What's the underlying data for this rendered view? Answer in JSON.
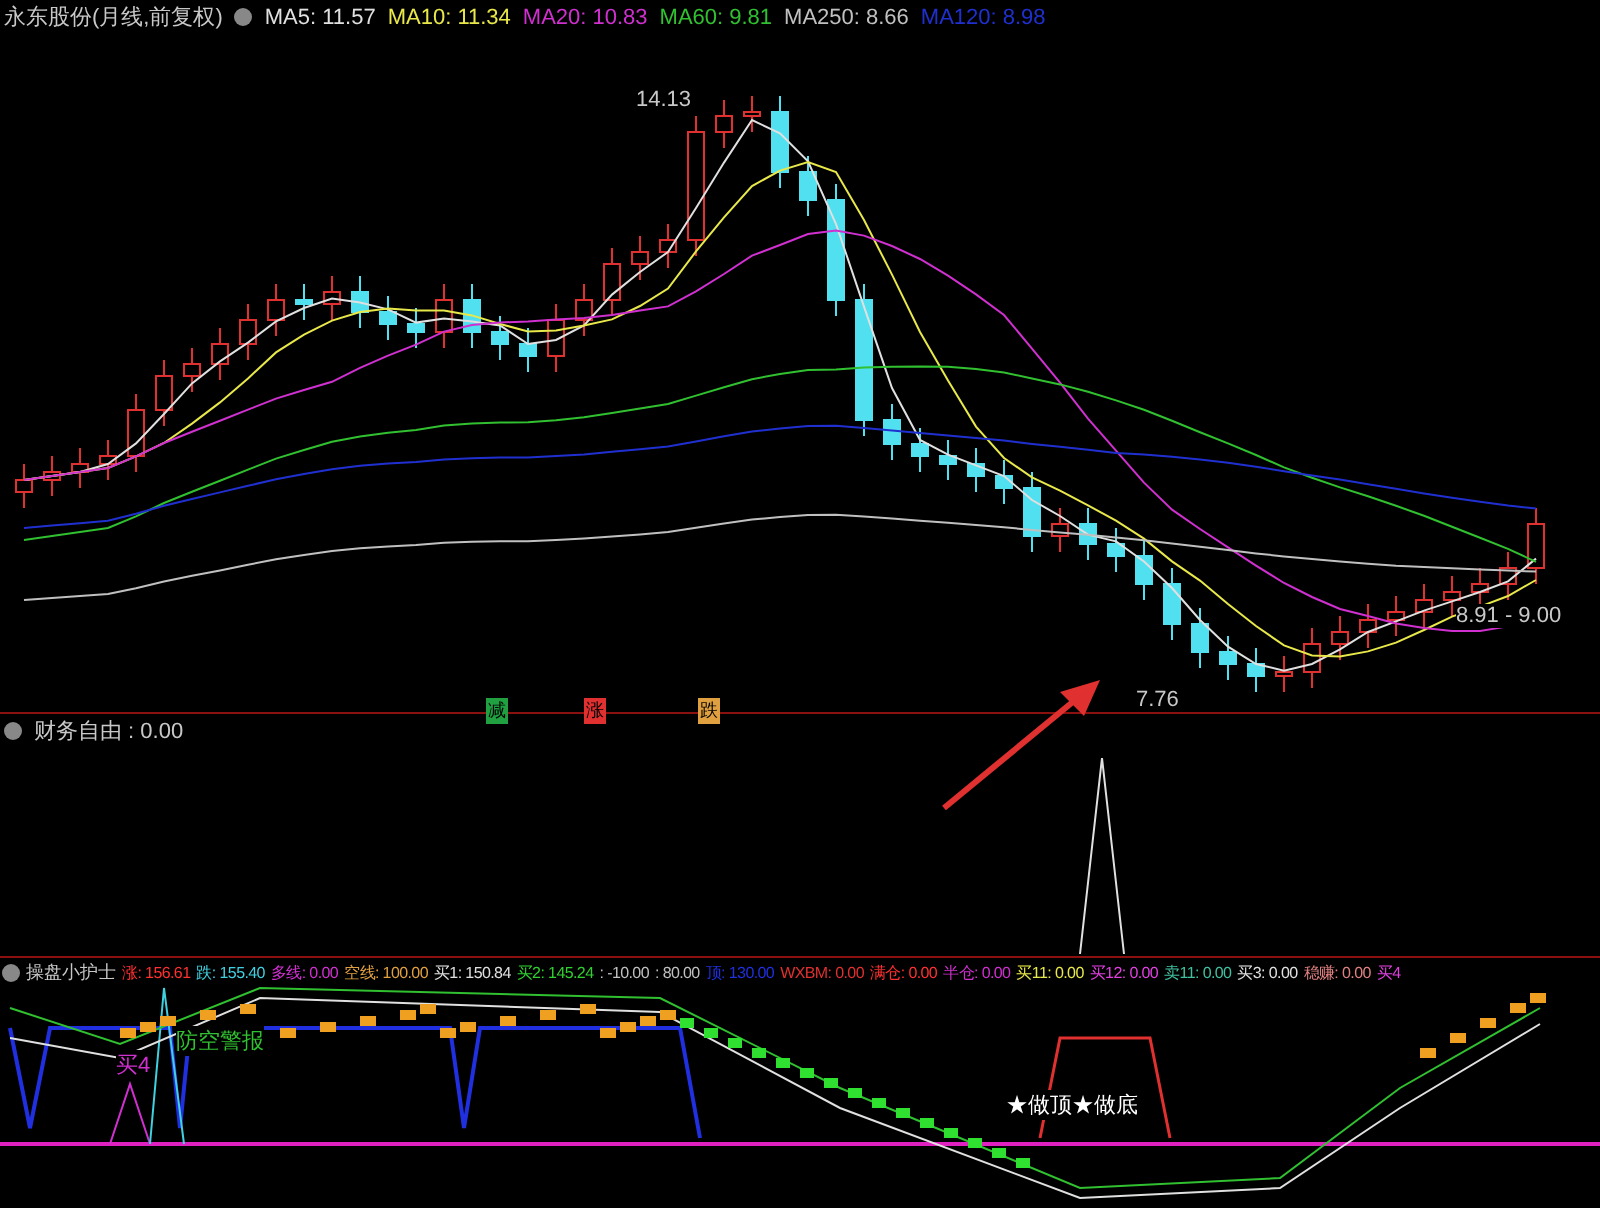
{
  "main_chart": {
    "title": "永东股份(月线,前复权)",
    "indicators": [
      {
        "label": "MA5: 11.57",
        "color": "#e0e0e0"
      },
      {
        "label": "MA10: 11.34",
        "color": "#e8e84a"
      },
      {
        "label": "MA20: 10.83",
        "color": "#d030d0"
      },
      {
        "label": "MA60: 9.81",
        "color": "#30c030"
      },
      {
        "label": "MA250: 8.66",
        "color": "#c0c0c0"
      },
      {
        "label": "MA120: 8.98",
        "color": "#2030d0"
      }
    ],
    "price_labels": [
      "14.13",
      "7.76",
      "8.91 - 9.00"
    ],
    "signal_tags": [
      {
        "text": "减",
        "color": "#20a040"
      },
      {
        "text": "涨",
        "color": "#e03030"
      },
      {
        "text": "跌",
        "color": "#e0a040"
      }
    ]
  },
  "sub_chart": {
    "title": "财务自由 : 0.00"
  },
  "nurse_chart": {
    "title": "操盘小护士",
    "readouts": [
      {
        "label": "涨: 156.61",
        "color": "#ff3030"
      },
      {
        "label": "跌: 155.40",
        "color": "#40d0e0"
      },
      {
        "label": "多线: 0.00",
        "color": "#d030d0"
      },
      {
        "label": "空线: 100.00",
        "color": "#e0a040"
      },
      {
        "label": "买1: 150.84",
        "color": "#e0e0e0"
      },
      {
        "label": "买2: 145.24",
        "color": "#30d030"
      },
      {
        "label": ": -10.00",
        "color": "#c0c0c0"
      },
      {
        "label": ": 80.00",
        "color": "#c0c0c0"
      },
      {
        "label": "顶: 130.00",
        "color": "#2030e0"
      },
      {
        "label": "WXBM: 0.00",
        "color": "#e03030"
      },
      {
        "label": "满仓: 0.00",
        "color": "#ff3030"
      },
      {
        "label": "半仓: 0.00",
        "color": "#d030d0"
      },
      {
        "label": "买11: 0.00",
        "color": "#e8e84a"
      },
      {
        "label": "买12: 0.00",
        "color": "#e040e0"
      },
      {
        "label": "卖11: 0.00",
        "color": "#40c0a0"
      },
      {
        "label": "买3: 0.00",
        "color": "#e0e0e0"
      },
      {
        "label": "稳赚: 0.00",
        "color": "#e08080"
      },
      {
        "label": "买4",
        "color": "#e040e0"
      }
    ],
    "chart_labels": [
      {
        "text": "防空警报",
        "color": "#30c030"
      },
      {
        "text": "买4",
        "color": "#d030d0"
      },
      {
        "text": "★做顶★做底",
        "color": "#ffffff"
      }
    ]
  }
}
